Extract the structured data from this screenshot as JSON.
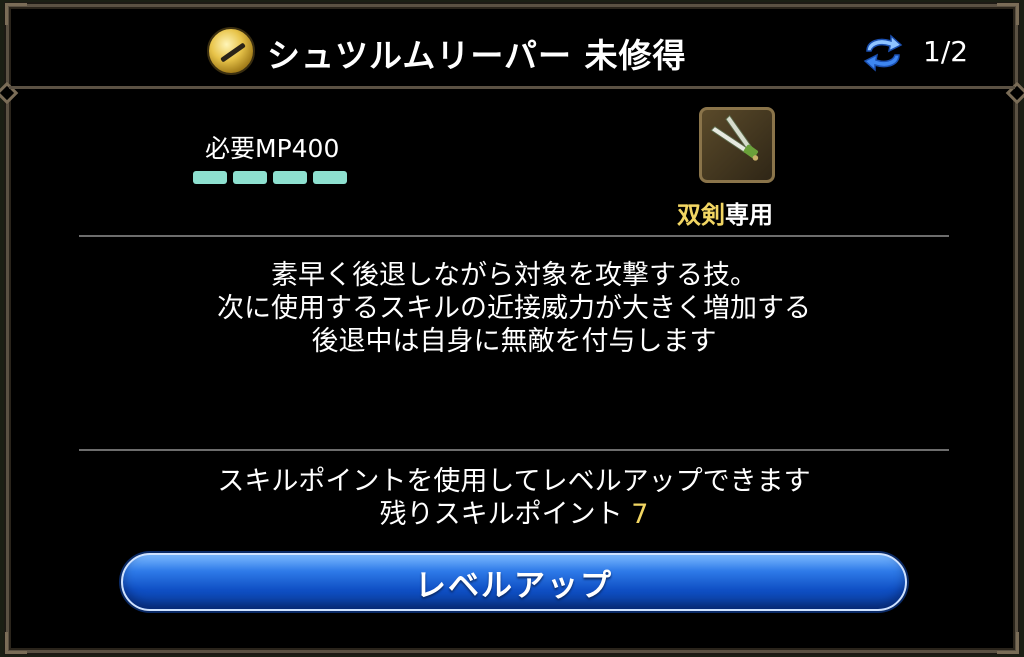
{
  "header": {
    "skill_icon": "skill-emblem-icon",
    "title": "シュツルムリーパー 未修得",
    "cycle_icon": "cycle-arrows-icon",
    "page": "1/2"
  },
  "requirements": {
    "mp_label": "必要MP400",
    "mp_pips": 4,
    "pip_color": "#8de0cf"
  },
  "weapon": {
    "icon": "dual-swords-icon",
    "type_name": "双剣",
    "suffix": "専用",
    "type_color": "#f2d663"
  },
  "description": {
    "line1": "素早く後退しながら対象を攻撃する技。",
    "line2": "次に使用するスキルの近接威力が大きく増加する",
    "line3": "後退中は自身に無敵を付与します"
  },
  "skill_points": {
    "info": "スキルポイントを使用してレベルアップできます",
    "remaining_label": "残りスキルポイント",
    "remaining_value": "7"
  },
  "actions": {
    "level_up_label": "レベルアップ"
  },
  "colors": {
    "accent_gold": "#f2d663",
    "button_blue": "#1f63d8",
    "frame": "#5b5143"
  }
}
